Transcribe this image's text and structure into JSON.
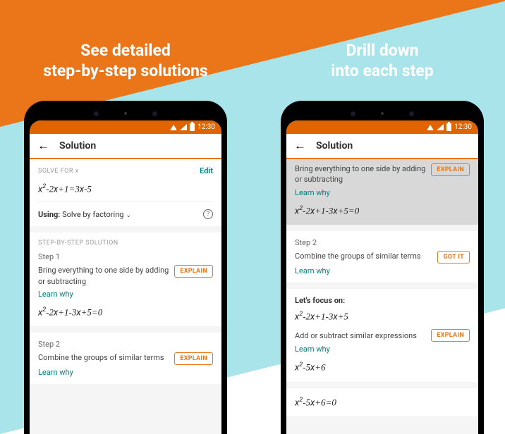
{
  "status": {
    "time": "12:30"
  },
  "appbar": {
    "title": "Solution"
  },
  "left": {
    "headline": "See detailed\nstep-by-step solutions",
    "solveFor": {
      "label": "SOLVE FOR x",
      "edit": "Edit"
    },
    "equation": "x²-2x+1=3x-5",
    "using": {
      "prefix": "Using:",
      "method": "Solve by factoring"
    },
    "stepsHeader": "STEP-BY-STEP SOLUTION",
    "step1": {
      "num": "Step 1",
      "desc": "Bring everything to one side by adding or subtracting",
      "btn": "EXPLAIN",
      "learn": "Learn why",
      "eq": "x²-2x+1-3x+5=0"
    },
    "step2": {
      "num": "Step 2",
      "desc": "Combine the groups of similar terms",
      "btn": "EXPLAIN",
      "learn": "Learn why"
    }
  },
  "right": {
    "headline": "Drill down\ninto each step",
    "step1": {
      "desc": "Bring everything to one side by adding or subtracting",
      "btn": "EXPLAIN",
      "learn": "Learn why",
      "eq": "x²-2x+1-3x+5=0"
    },
    "step2": {
      "num": "Step 2",
      "desc": "Combine the groups of similar terms",
      "btn": "GOT IT",
      "learn": "Learn why"
    },
    "focus": {
      "header": "Let's focus on:",
      "eq1": "x²-2x+1-3x+5",
      "subDesc": "Add or subtract similar expressions",
      "btn": "EXPLAIN",
      "learn": "Learn why",
      "eq2": "x²-5x+6"
    },
    "result": {
      "eq": "x²-5x+6=0"
    }
  }
}
